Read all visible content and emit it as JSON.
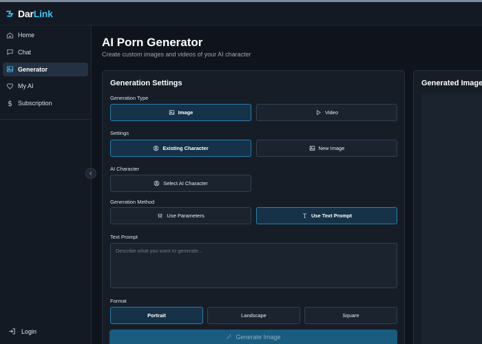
{
  "brand": {
    "name_prefix": "Dar",
    "name_suffix": "Link",
    "accent": "#3ec0f0"
  },
  "sidebar": {
    "items": [
      {
        "label": "Home",
        "icon": "home-icon",
        "active": false
      },
      {
        "label": "Chat",
        "icon": "chat-icon",
        "active": false
      },
      {
        "label": "Generator",
        "icon": "image-icon",
        "active": true
      },
      {
        "label": "My AI",
        "icon": "heart-icon",
        "active": false
      },
      {
        "label": "Subscription",
        "icon": "dollar-icon",
        "active": false
      }
    ],
    "login_label": "Login"
  },
  "page": {
    "title": "AI Porn Generator",
    "subtitle": "Create custom images and videos of your AI character"
  },
  "settings": {
    "title": "Generation Settings",
    "generation_type": {
      "label": "Generation Type",
      "options": [
        "Image",
        "Video"
      ],
      "selected": "Image"
    },
    "settings_group": {
      "label": "Settings",
      "options": [
        "Existing Character",
        "New Image"
      ],
      "selected": "Existing Character"
    },
    "ai_character": {
      "label": "AI Character",
      "button": "Select AI Character"
    },
    "generation_method": {
      "label": "Generation Method",
      "options": [
        "Use Parameters",
        "Use Text Prompt"
      ],
      "selected": "Use Text Prompt"
    },
    "text_prompt": {
      "label": "Text Prompt",
      "placeholder": "Describe what you want to generate...",
      "value": ""
    },
    "format": {
      "label": "Format",
      "options": [
        "Portrait",
        "Landscape",
        "Square"
      ],
      "selected": "Portrait"
    },
    "generate_label": "Generate Image"
  },
  "result": {
    "title": "Generated Image"
  },
  "colors": {
    "background": "#0f141c",
    "panel": "#161d27",
    "selected": "#153248",
    "selected_border": "#2a7fb0"
  }
}
